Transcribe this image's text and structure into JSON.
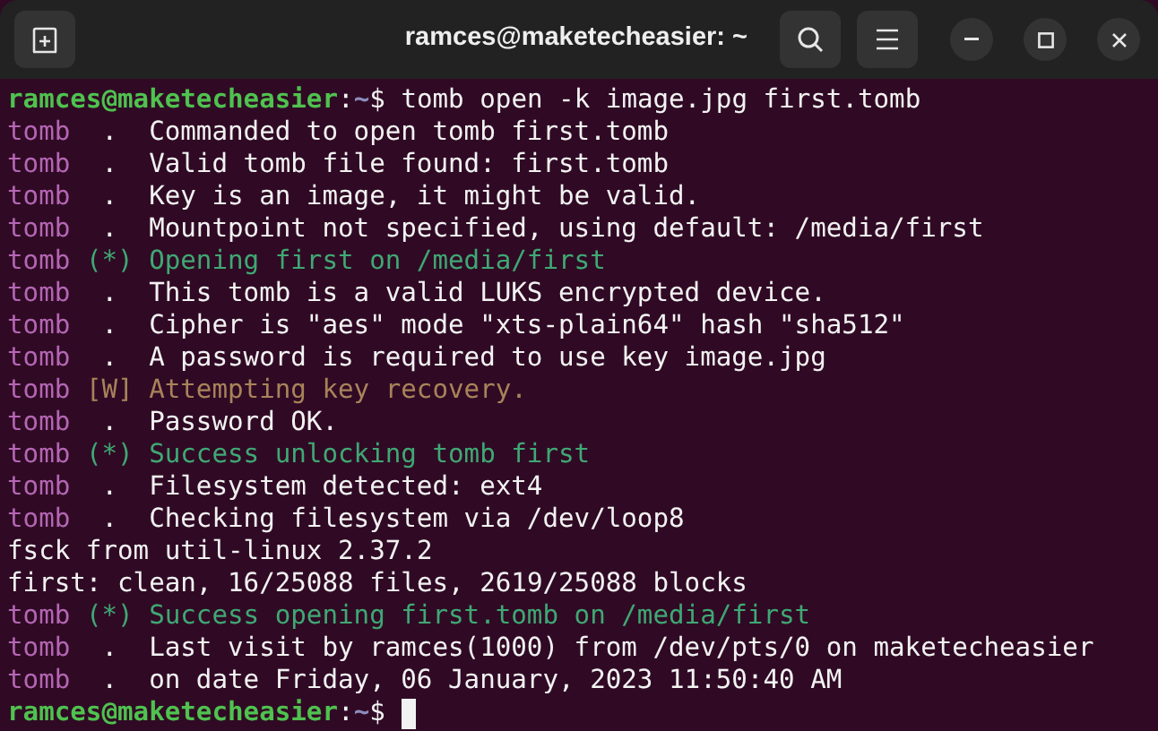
{
  "window": {
    "title": "ramces@maketecheasier: ~"
  },
  "lines": [
    {
      "kind": "prompt",
      "user": "ramces@maketecheasier",
      "separator": ":",
      "path": "~",
      "symbol": "$",
      "command": "tomb open -k image.jpg first.tomb"
    },
    {
      "kind": "info",
      "tag": "tomb",
      "marker": ".",
      "text": "Commanded to open tomb first.tomb"
    },
    {
      "kind": "info",
      "tag": "tomb",
      "marker": ".",
      "text": "Valid tomb file found: first.tomb"
    },
    {
      "kind": "info",
      "tag": "tomb",
      "marker": ".",
      "text": "Key is an image, it might be valid."
    },
    {
      "kind": "info",
      "tag": "tomb",
      "marker": ".",
      "text": "Mountpoint not specified, using default: /media/first"
    },
    {
      "kind": "success",
      "tag": "tomb",
      "marker": "(*)",
      "text": "Opening first on /media/first"
    },
    {
      "kind": "info",
      "tag": "tomb",
      "marker": ".",
      "text": "This tomb is a valid LUKS encrypted device."
    },
    {
      "kind": "info",
      "tag": "tomb",
      "marker": ".",
      "text": "Cipher is \"aes\" mode \"xts-plain64\" hash \"sha512\""
    },
    {
      "kind": "info",
      "tag": "tomb",
      "marker": ".",
      "text": "A password is required to use key image.jpg"
    },
    {
      "kind": "warning",
      "tag": "tomb",
      "marker": "[W]",
      "text": "Attempting key recovery."
    },
    {
      "kind": "info",
      "tag": "tomb",
      "marker": ".",
      "text": "Password OK."
    },
    {
      "kind": "success",
      "tag": "tomb",
      "marker": "(*)",
      "text": "Success unlocking tomb first"
    },
    {
      "kind": "info",
      "tag": "tomb",
      "marker": ".",
      "text": "Filesystem detected: ext4"
    },
    {
      "kind": "info",
      "tag": "tomb",
      "marker": ".",
      "text": "Checking filesystem via /dev/loop8"
    },
    {
      "kind": "plain",
      "text": "fsck from util-linux 2.37.2"
    },
    {
      "kind": "plain",
      "text": "first: clean, 16/25088 files, 2619/25088 blocks"
    },
    {
      "kind": "success",
      "tag": "tomb",
      "marker": "(*)",
      "text": "Success opening first.tomb on /media/first"
    },
    {
      "kind": "info",
      "tag": "tomb",
      "marker": ".",
      "text": "Last visit by ramces(1000) from /dev/pts/0 on maketecheasier"
    },
    {
      "kind": "info",
      "tag": "tomb",
      "marker": ".",
      "text": "on date Friday, 06 January, 2023 11:50:40 AM"
    },
    {
      "kind": "prompt",
      "user": "ramces@maketecheasier",
      "separator": ":",
      "path": "~",
      "symbol": "$",
      "cursor": true
    }
  ]
}
